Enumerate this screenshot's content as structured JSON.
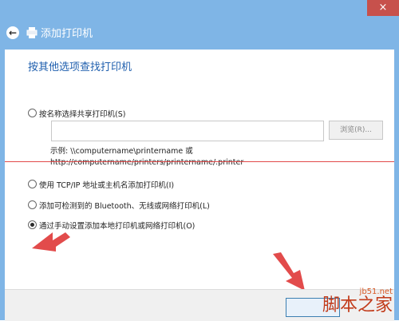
{
  "window": {
    "close_glyph": "×",
    "title": "添加打印机",
    "back_glyph": "←"
  },
  "content": {
    "heading": "按其他选项查找打印机",
    "options": [
      {
        "label": "按名称选择共享打印机(S)",
        "checked": false
      },
      {
        "label": "使用 TCP/IP 地址或主机名添加打印机(I)",
        "checked": false
      },
      {
        "label": "添加可检测到的 Bluetooth、无线或网络打印机(L)",
        "checked": false
      },
      {
        "label": "通过手动设置添加本地打印机或网络打印机(O)",
        "checked": true
      }
    ],
    "share_input": {
      "value": "",
      "placeholder": ""
    },
    "browse_label": "浏览(R)...",
    "example_line1": "示例: \\\\computername\\printername 或",
    "example_line2": "http://computername/printers/printername/.printer"
  },
  "watermark": {
    "site": "jb51.net",
    "brand": "脚本之家"
  },
  "colors": {
    "header": "#7fb5e6",
    "heading_text": "#1f5fae",
    "annotation": "#e24b4b"
  }
}
